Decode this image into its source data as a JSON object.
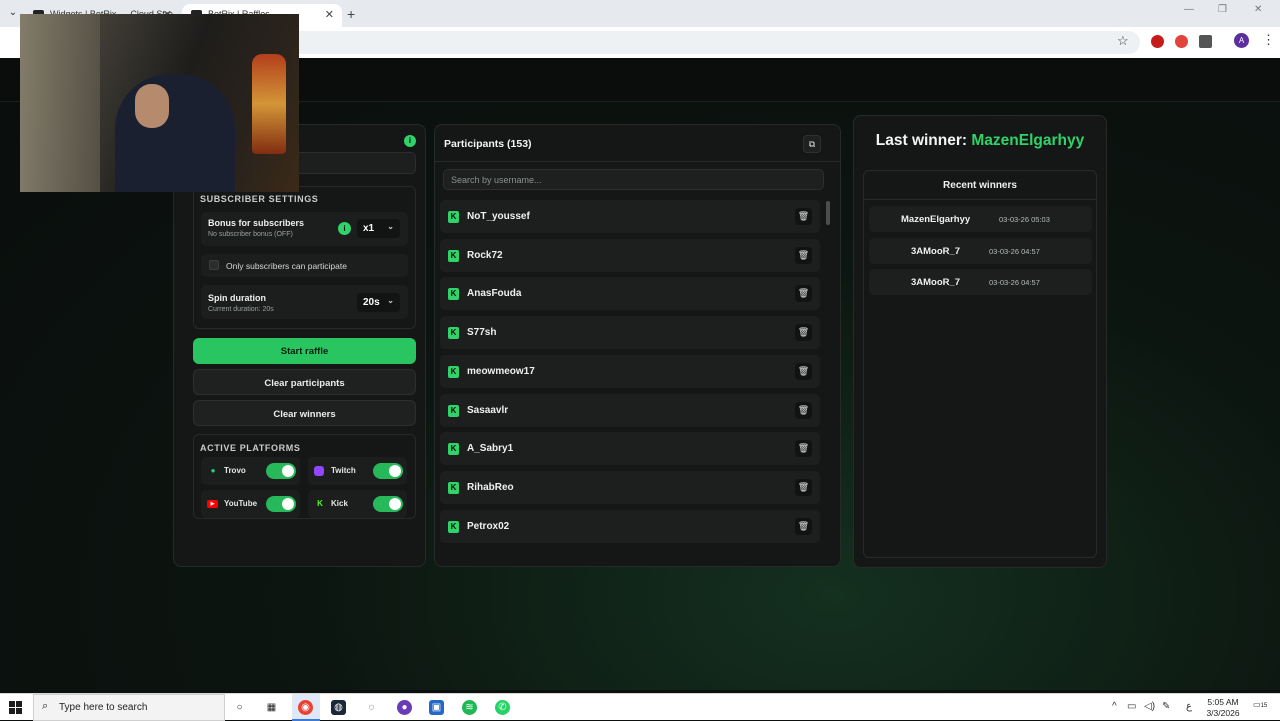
{
  "browser": {
    "tabs": [
      {
        "title": "Widgets | BotRix — Cloud Stre..."
      },
      {
        "title": "BotRix | Raffles"
      }
    ],
    "new_tab": "+"
  },
  "left": {
    "subscriber_settings_title": "SUBSCRIBER SETTINGS",
    "bonus_title": "Bonus for subscribers",
    "bonus_sub": "No subscriber bonus (OFF)",
    "bonus_value": "x1",
    "only_subs_label": "Only subscribers can participate",
    "spin_title": "Spin duration",
    "spin_sub": "Current duration: 20s",
    "spin_value": "20s",
    "start_button": "Start raffle",
    "clear_participants_button": "Clear participants",
    "clear_winners_button": "Clear winners",
    "platforms_title": "ACTIVE PLATFORMS",
    "platforms": [
      {
        "name": "Trovo",
        "color": "#1fd37f",
        "icon": "trovo-icon",
        "enabled": true
      },
      {
        "name": "Twitch",
        "color": "#9146ff",
        "icon": "twitch-icon",
        "enabled": true
      },
      {
        "name": "YouTube",
        "color": "#ff0000",
        "icon": "youtube-icon",
        "enabled": true
      },
      {
        "name": "Kick",
        "color": "#53fc18",
        "icon": "kick-icon",
        "enabled": true
      }
    ]
  },
  "participants": {
    "title": "Participants (153)",
    "search_placeholder": "Search by username...",
    "items": [
      "NoT_youssef",
      "Rock72",
      "AnasFouda",
      "S77sh",
      "meowmeow17",
      "Sasaavlr",
      "A_Sabry1",
      "RihabReo",
      "Petrox02"
    ]
  },
  "winners": {
    "last_label": "Last winner: ",
    "last_name": "MazenElgarhyy",
    "recent_title": "Recent winners",
    "recent": [
      {
        "name": "MazenElgarhyy",
        "time": "03-03-26 05:03"
      },
      {
        "name": "3AMooR_7",
        "time": "03-03-26 04:57"
      },
      {
        "name": "3AMooR_7",
        "time": "03-03-26 04:57"
      }
    ]
  },
  "taskbar": {
    "search_placeholder": "Type here to search",
    "time": "5:05 AM",
    "date": "3/3/2026",
    "lang": "ع",
    "notifications": "15"
  },
  "colors": {
    "accent": "#2fd36a",
    "panel": "#141716"
  }
}
